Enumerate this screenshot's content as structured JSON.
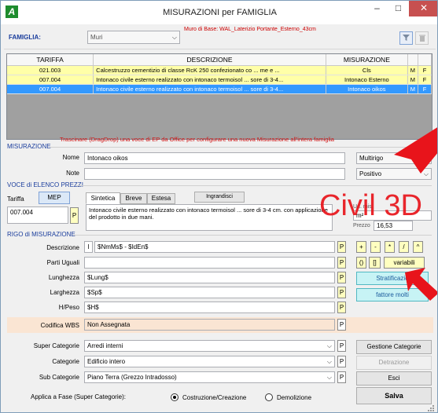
{
  "window": {
    "title": "MISURAZIONI per FAMIGLIA",
    "app_icon_letter": "A",
    "minimize": "–",
    "maximize": "□",
    "close": "✕"
  },
  "famiglia": {
    "label": "FAMIGLIA:",
    "value": "Muri",
    "muro_di_base": "Muro di Base: WAL_Laterizio Portante_Esterno_43cm"
  },
  "grid": {
    "headers": [
      "TARIFFA",
      "DESCRIZIONE",
      "MISURAZIONE",
      "",
      ""
    ],
    "rows": [
      {
        "tariffa": "021.003",
        "descrizione": "Calcestruzzo cementizio di classe RcK 250 confezionato co ... me e ...",
        "misurazione": "Cls",
        "m": "M",
        "f": "F"
      },
      {
        "tariffa": "007.004",
        "descrizione": "Intonaco civile esterno realizzato con intonaco termoisol ... sore di 3-4...",
        "misurazione": "Intonaco Esterno",
        "m": "M",
        "f": "F"
      },
      {
        "tariffa": "007.004",
        "descrizione": "Intonaco civile esterno realizzato con intonaco termoisol ... sore di 3-4...",
        "misurazione": "Intonaco oikos",
        "m": "M",
        "f": "F"
      }
    ]
  },
  "hint": "Trascinare (DragDrop) una voce di EP da Office per configurare una nuova Misurazione all'intera famiglia",
  "misurazione": {
    "section": "MISURAZIONE",
    "nome_label": "Nome",
    "nome_value": "Intonaco oikos",
    "note_label": "Note",
    "note_value": "",
    "tipo_value": "Multirigo",
    "segno_value": "Positivo"
  },
  "voce": {
    "section": "VOCE di ELENCO PREZZI",
    "tariffa_label": "Tariffa",
    "mep_button": "MEP",
    "tariffa_value": "007.004",
    "p": "P",
    "tab_sintetica": "Sintetica",
    "tab_breve": "Breve",
    "tab_estesa": "Estesa",
    "ingrandisci": "Ingrandisci",
    "descrizione_text": "Intonaco civile esterno realizzato con intonaco termoisol ... sore di 3-4 cm. con applicazione del prodotto in due mani.",
    "unita_label": "Un. mis.",
    "unita_value": "m²",
    "prezzo_label": "Prezzo",
    "prezzo_value": "16,53"
  },
  "watermark": "Civil 3D",
  "rigo": {
    "section": "RIGO di MISURAZIONE",
    "descrizione_label": "Descrizione",
    "descrizione_prefix": "I",
    "descrizione_value": "$NmMs$ - $IdEn$",
    "parti_label": "Parti Uguali",
    "parti_value": "",
    "lunghezza_label": "Lunghezza",
    "lunghezza_value": "$Lung$",
    "larghezza_label": "Larghezza",
    "larghezza_value": "$Sp$",
    "hpeso_label": "H/Peso",
    "hpeso_value": "$H$",
    "ops": [
      "+",
      "-",
      "*",
      "/",
      "^"
    ],
    "brackets": [
      "()",
      "[]"
    ],
    "variabili": "variabili",
    "stratificazione": "Stratificazio",
    "fattore": "fattore molti"
  },
  "wbs": {
    "label": "Codifica WBS",
    "value": "Non Assegnata"
  },
  "categorie": {
    "super_label": "Super Categorie",
    "super_value": "Arredi interni",
    "cat_label": "Categorie",
    "cat_value": "Edificio intero",
    "sub_label": "Sub Categorie",
    "sub_value": "Piano Terra (Grezzo Intradosso)"
  },
  "actions": {
    "gestione": "Gestione Categorie",
    "detrazione": "Detrazione",
    "esci": "Esci",
    "salva": "Salva"
  },
  "fase": {
    "label": "Applica a Fase (Super Categorie):",
    "option1": "Costruzione/Creazione",
    "option2": "Demolizione"
  },
  "colors": {
    "accent_red": "#e8141b",
    "selection_blue": "#3399ff",
    "row_yellow": "#ffffa8",
    "section_blue": "#1a3d9c",
    "wbs_bg": "#fae5d3",
    "cyan_button": "#c7f3f5"
  }
}
